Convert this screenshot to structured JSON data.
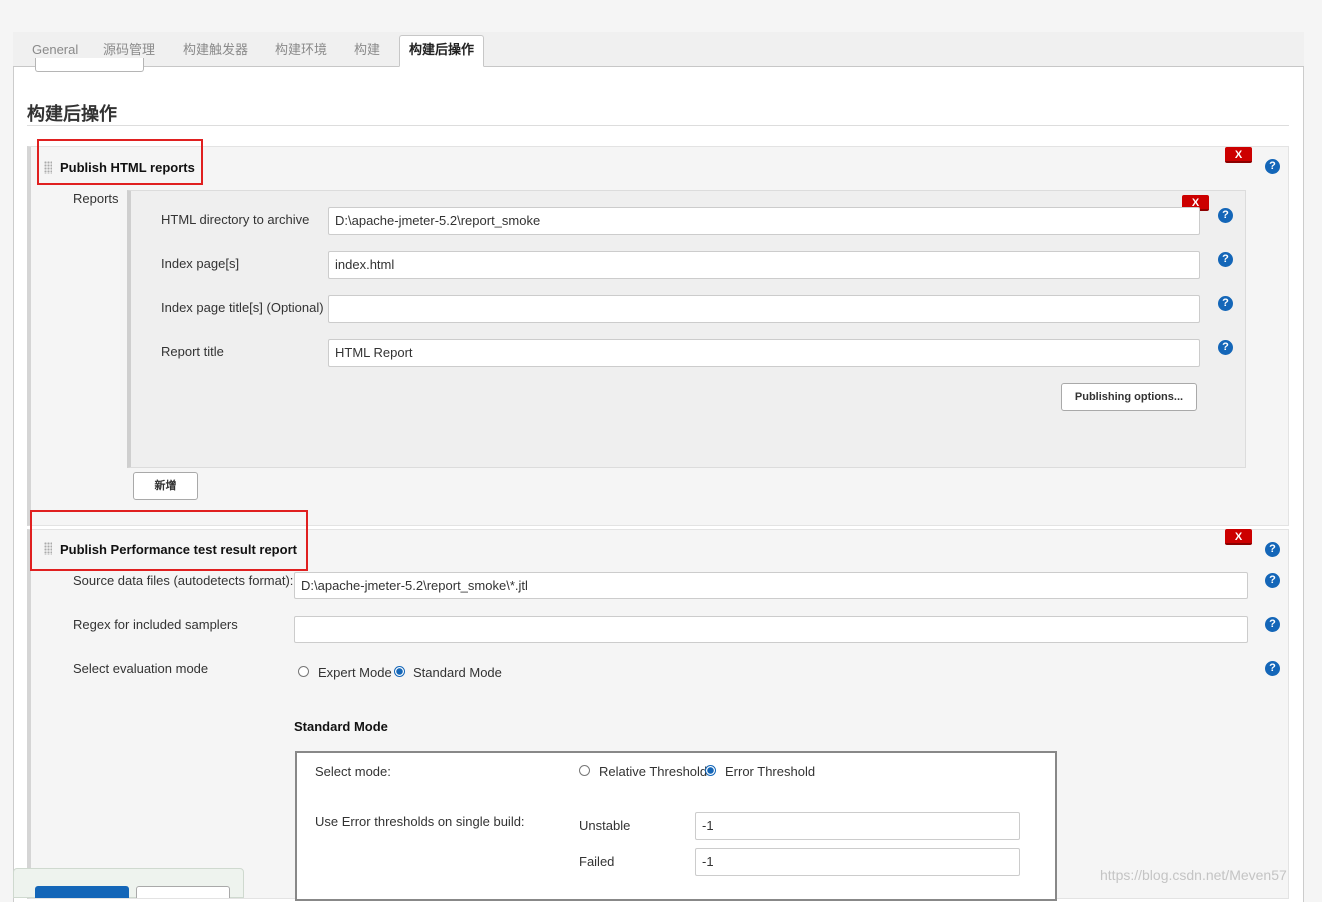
{
  "tabs": [
    {
      "label": "General"
    },
    {
      "label": "源码管理"
    },
    {
      "label": "构建触发器"
    },
    {
      "label": "构建环境"
    },
    {
      "label": "构建"
    },
    {
      "label": "构建后操作"
    }
  ],
  "section_title": "构建后操作",
  "html_publisher": {
    "title": "Publish HTML reports",
    "delete_label": "X",
    "reports_label": "Reports",
    "fields": {
      "html_dir": {
        "label": "HTML directory to archive",
        "value": "D:\\apache-jmeter-5.2\\report_smoke"
      },
      "index_pages": {
        "label": "Index page[s]",
        "value": "index.html"
      },
      "index_titles": {
        "label": "Index page title[s] (Optional)",
        "value": ""
      },
      "report_title": {
        "label": "Report title",
        "value": "HTML Report"
      }
    },
    "publishing_options_button": "Publishing options...",
    "add_button": "新增"
  },
  "performance_publisher": {
    "title": "Publish Performance test result report",
    "delete_label": "X",
    "source_files": {
      "label": "Source data files (autodetects format):",
      "value": "D:\\apache-jmeter-5.2\\report_smoke\\*.jtl"
    },
    "regex": {
      "label": "Regex for included samplers",
      "value": ""
    },
    "evaluation_mode": {
      "label": "Select evaluation mode",
      "options": [
        "Expert Mode",
        "Standard Mode"
      ],
      "selected": "Standard Mode"
    },
    "standard_mode": {
      "heading": "Standard Mode",
      "select_mode_label": "Select mode:",
      "modes": [
        "Relative Threshold",
        "Error Threshold"
      ],
      "selected": "Error Threshold",
      "error_thresholds_label": "Use Error thresholds on single build:",
      "unstable": {
        "label": "Unstable",
        "value": "-1"
      },
      "failed": {
        "label": "Failed",
        "value": "-1"
      }
    }
  },
  "help_glyph": "?",
  "watermark": "https://blog.csdn.net/Meven57"
}
